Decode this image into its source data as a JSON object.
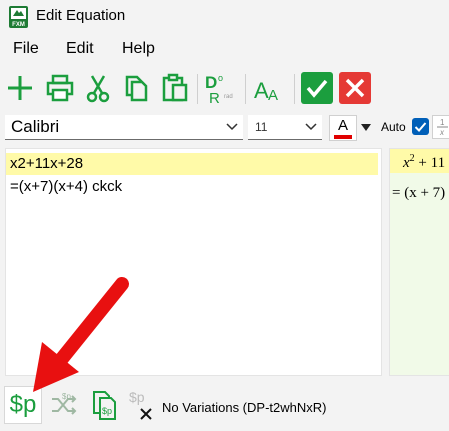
{
  "window": {
    "title": "Edit Equation",
    "app_icon_text": "FXM"
  },
  "menu": {
    "items": [
      "File",
      "Edit",
      "Help"
    ]
  },
  "format": {
    "font": "Calibri",
    "size": "11",
    "color_button_letter": "A",
    "auto_label": "Auto",
    "auto_checked": true,
    "font_color": "#e00000",
    "fraction_glyph": "1/x"
  },
  "toolbar": {
    "d_button_sup": "o",
    "d_button_sub": "rad"
  },
  "editor": {
    "lines": [
      "x2+11x+28",
      "=(x+7)(x+4) ckck"
    ]
  },
  "preview": {
    "line1_base": "x",
    "line1_sup": "2",
    "line1_rest": " + 11",
    "line2": "= (x + 7)"
  },
  "bottom": {
    "dollar_label": "$p",
    "status": "No Variations (DP-t2whNxR)"
  },
  "colors": {
    "accent_green": "#1b9e3e",
    "cancel_red": "#e53935",
    "highlight_yellow": "#fffaa8",
    "arrow_red": "#e81010"
  }
}
